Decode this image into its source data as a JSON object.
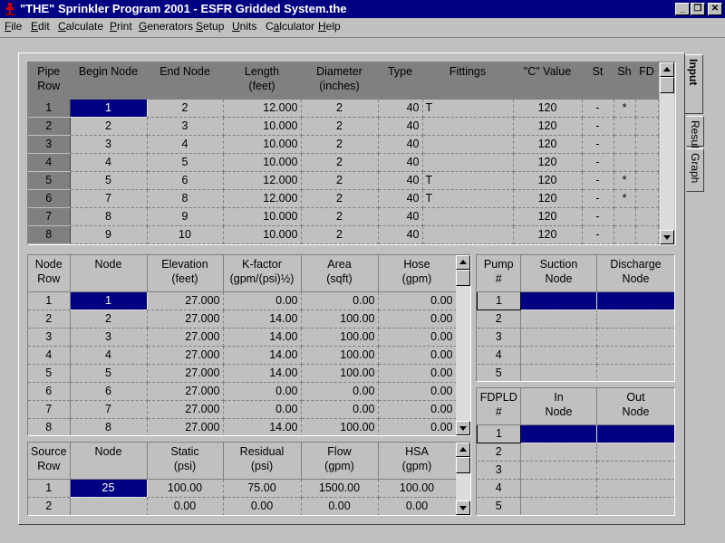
{
  "window": {
    "title": "\"THE\" Sprinkler Program 2001 - ESFR Gridded System.the",
    "minimize": "_",
    "restore": "❐",
    "close": "✕"
  },
  "menu": [
    {
      "label": "File",
      "key": "F",
      "rest": "ile"
    },
    {
      "label": "Edit",
      "key": "E",
      "rest": "dit"
    },
    {
      "label": "Calculate",
      "key": "C",
      "rest": "alculate"
    },
    {
      "label": "Print",
      "key": "P",
      "rest": "rint"
    },
    {
      "label": "Generators",
      "key": "G",
      "rest": "enerators"
    },
    {
      "label": "Setup",
      "key": "S",
      "rest": "etup"
    },
    {
      "label": "Units",
      "key": "U",
      "rest": "nits"
    },
    {
      "label": "Calculator",
      "key": "a",
      "pre": "C",
      "rest": "lculator"
    },
    {
      "label": "Help",
      "key": "H",
      "rest": "elp"
    }
  ],
  "tabs": [
    "Input",
    "Results",
    "Graph"
  ],
  "pipe": {
    "headers": [
      "Pipe\nRow",
      "Begin Node",
      "End Node",
      "Length\n(feet)",
      "Diameter\n(inches)",
      "Type",
      "Fittings",
      "\"C\" Value",
      "St",
      "Sh",
      "FD"
    ],
    "rows": [
      [
        "1",
        "1",
        "2",
        "12.000",
        "2",
        "40",
        "T",
        "120",
        "-",
        "*",
        ""
      ],
      [
        "2",
        "2",
        "3",
        "10.000",
        "2",
        "40",
        "",
        "120",
        "-",
        "",
        ""
      ],
      [
        "3",
        "3",
        "4",
        "10.000",
        "2",
        "40",
        "",
        "120",
        "-",
        "",
        ""
      ],
      [
        "4",
        "4",
        "5",
        "10.000",
        "2",
        "40",
        "",
        "120",
        "-",
        "",
        ""
      ],
      [
        "5",
        "5",
        "6",
        "12.000",
        "2",
        "40",
        "T",
        "120",
        "-",
        "*",
        ""
      ],
      [
        "6",
        "7",
        "8",
        "12.000",
        "2",
        "40",
        "T",
        "120",
        "-",
        "*",
        ""
      ],
      [
        "7",
        "8",
        "9",
        "10.000",
        "2",
        "40",
        "",
        "120",
        "-",
        "",
        ""
      ],
      [
        "8",
        "9",
        "10",
        "10.000",
        "2",
        "40",
        "",
        "120",
        "-",
        "",
        ""
      ]
    ]
  },
  "node": {
    "headers": [
      "Node\nRow",
      "Node",
      "Elevation\n(feet)",
      "K-factor\n(gpm/(psi)½)",
      "Area\n(sqft)",
      "Hose\n(gpm)"
    ],
    "rows": [
      [
        "1",
        "1",
        "27.000",
        "0.00",
        "0.00",
        "0.00"
      ],
      [
        "2",
        "2",
        "27.000",
        "14.00",
        "100.00",
        "0.00"
      ],
      [
        "3",
        "3",
        "27.000",
        "14.00",
        "100.00",
        "0.00"
      ],
      [
        "4",
        "4",
        "27.000",
        "14.00",
        "100.00",
        "0.00"
      ],
      [
        "5",
        "5",
        "27.000",
        "14.00",
        "100.00",
        "0.00"
      ],
      [
        "6",
        "6",
        "27.000",
        "0.00",
        "0.00",
        "0.00"
      ],
      [
        "7",
        "7",
        "27.000",
        "0.00",
        "0.00",
        "0.00"
      ],
      [
        "8",
        "8",
        "27.000",
        "14.00",
        "100.00",
        "0.00"
      ]
    ]
  },
  "source": {
    "headers": [
      "Source\nRow",
      "Node",
      "Static\n(psi)",
      "Residual\n(psi)",
      "Flow\n(gpm)",
      "HSA\n(gpm)"
    ],
    "rows": [
      [
        "1",
        "25",
        "100.00",
        "75.00",
        "1500.00",
        "100.00"
      ],
      [
        "2",
        "",
        "0.00",
        "0.00",
        "0.00",
        "0.00"
      ]
    ]
  },
  "pump": {
    "headers": [
      "Pump\n#",
      "Suction\nNode",
      "Discharge\nNode"
    ],
    "rows": [
      [
        "1",
        "",
        ""
      ],
      [
        "2",
        "",
        ""
      ],
      [
        "3",
        "",
        ""
      ],
      [
        "4",
        "",
        ""
      ],
      [
        "5",
        "",
        ""
      ]
    ]
  },
  "fdpld": {
    "headers": [
      "FDPLD\n#",
      "In\nNode",
      "Out\nNode"
    ],
    "rows": [
      [
        "1",
        "",
        ""
      ],
      [
        "2",
        "",
        ""
      ],
      [
        "3",
        "",
        ""
      ],
      [
        "4",
        "",
        ""
      ],
      [
        "5",
        "",
        ""
      ]
    ]
  }
}
